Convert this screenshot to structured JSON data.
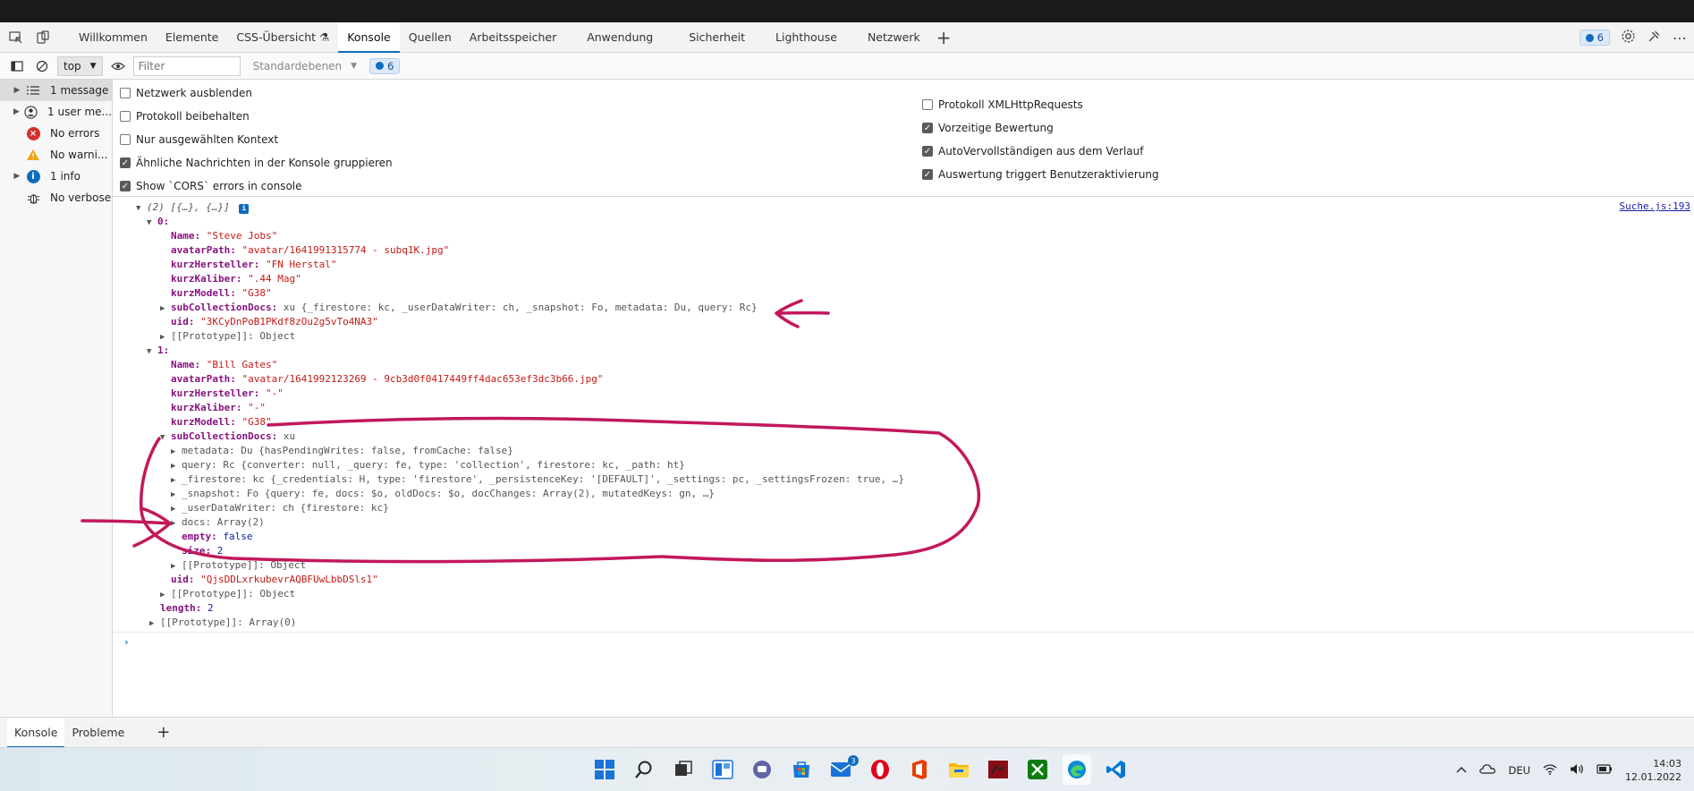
{
  "tabs": {
    "items": [
      "Willkommen",
      "Elemente",
      "CSS-Übersicht",
      "Konsole",
      "Quellen",
      "Arbeitsspeicher",
      "Anwendung",
      "Sicherheit",
      "Lighthouse",
      "Netzwerk"
    ],
    "issue_count": "6"
  },
  "toolbar": {
    "context": "top",
    "filter_placeholder": "Filter",
    "levels": "Standardebenen",
    "issue_count": "6"
  },
  "sidebar": {
    "items": [
      "1 message",
      "1 user me...",
      "No errors",
      "No warni...",
      "1 info",
      "No verbose"
    ]
  },
  "settings": {
    "left": [
      "Netzwerk ausblenden",
      "Protokoll beibehalten",
      "Nur ausgewählten Kontext",
      "Ähnliche Nachrichten in der Konsole gruppieren",
      "Show `CORS` errors in console"
    ],
    "right": [
      "Protokoll XMLHttpRequests",
      "Vorzeitige Bewertung",
      "AutoVervollständigen aus dem Verlauf",
      "Auswertung triggert Benutzeraktivierung"
    ]
  },
  "console": {
    "source_link": "Suche.js:193",
    "header": "(2) [{…}, {…}]",
    "item0": {
      "index": "0:",
      "name_key": "Name:",
      "name_val": "\"Steve Jobs\"",
      "avatar_key": "avatarPath:",
      "avatar_val": "\"avatar/1641991315774 - subq1K.jpg\"",
      "hersteller_key": "kurzHersteller:",
      "hersteller_val": "\"FN Herstal\"",
      "kaliber_key": "kurzKaliber:",
      "kaliber_val": "\".44 Mag\"",
      "modell_key": "kurzModell:",
      "modell_val": "\"G38\"",
      "sub_key": "subCollectionDocs:",
      "sub_val": "xu {_firestore: kc, _userDataWriter: ch, _snapshot: Fo, metadata: Du, query: Rc}",
      "uid_key": "uid:",
      "uid_val": "\"3KCyDnPoB1PKdf8zOu2g5vTo4NA3\"",
      "proto": "[[Prototype]]: Object"
    },
    "item1": {
      "index": "1:",
      "name_key": "Name:",
      "name_val": "\"Bill Gates\"",
      "avatar_key": "avatarPath:",
      "avatar_val": "\"avatar/1641992123269 - 9cb3d0f0417449ff4dac653ef3dc3b66.jpg\"",
      "hersteller_key": "kurzHersteller:",
      "hersteller_val": "\"-\"",
      "kaliber_key": "kurzKaliber:",
      "kaliber_val": "\"-\"",
      "modell_key": "kurzModell:",
      "modell_val": "\"G38\"",
      "sub_key": "subCollectionDocs:",
      "sub_val": "xu",
      "metadata": "metadata: Du {hasPendingWrites: false, fromCache: false}",
      "query": "query: Rc {converter: null, _query: fe, type: 'collection', firestore: kc, _path: ht}",
      "firestore": "_firestore: kc {_credentials: H, type: 'firestore', _persistenceKey: '[DEFAULT]', _settings: pc, _settingsFrozen: true, …}",
      "snapshot": "_snapshot: Fo {query: fe, docs: $o, oldDocs: $o, docChanges: Array(2), mutatedKeys: gn, …}",
      "writer": "_userDataWriter: ch {firestore: kc}",
      "docs": "docs: Array(2)",
      "empty_key": "empty:",
      "empty_val": "false",
      "size_key": "size:",
      "size_val": "2",
      "sub_proto": "[[Prototype]]: Object",
      "uid_key": "uid:",
      "uid_val": "\"QjsDDLxrkubevrAQBFUwLbbDSls1\"",
      "proto": "[[Prototype]]: Object"
    },
    "length_key": "length:",
    "length_val": "2",
    "array_proto": "[[Prototype]]: Array(0)"
  },
  "drawer": {
    "tabs": [
      "Konsole",
      "Probleme"
    ]
  },
  "taskbar": {
    "mail_badge": "3",
    "lang": "DEU",
    "time": "14:03",
    "date": "12.01.2022"
  },
  "colors": {
    "accent": "#0f6cbd",
    "annotation": "#c2185b"
  }
}
